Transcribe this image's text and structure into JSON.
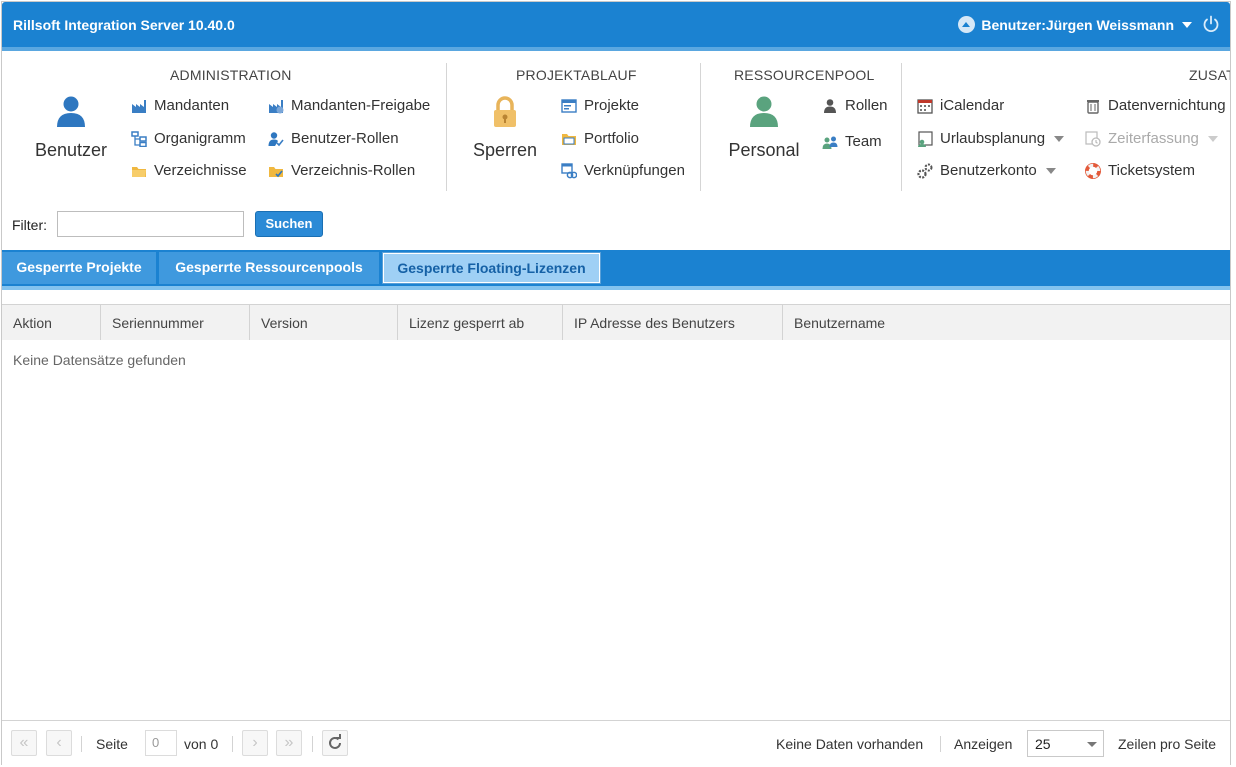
{
  "app": {
    "title": "Rillsoft Integration Server 10.40.0",
    "user_label": "Benutzer:Jürgen Weissmann"
  },
  "ribbon": {
    "administration": {
      "title": "ADMINISTRATION",
      "big_button": "Benutzer",
      "items": [
        "Mandanten",
        "Organigramm",
        "Verzeichnisse",
        "Mandanten-Freigabe",
        "Benutzer-Rollen",
        "Verzeichnis-Rollen"
      ]
    },
    "projektablauf": {
      "title": "PROJEKTABLAUF",
      "big_button": "Sperren",
      "items": [
        "Projekte",
        "Portfolio",
        "Verknüpfungen"
      ]
    },
    "ressourcenpool": {
      "title": "RESSOURCENPOOL",
      "big_button": "Personal",
      "items": [
        "Rollen",
        "Team"
      ]
    },
    "zusatz": {
      "title": "ZUSAT",
      "items": [
        "iCalendar",
        "Urlaubsplanung",
        "Benutzerkonto",
        "Datenvernichtung",
        "Zeiterfassung",
        "Ticketsystem"
      ]
    }
  },
  "filter": {
    "label": "Filter:",
    "value": "",
    "button": "Suchen"
  },
  "tabs": [
    {
      "label": "Gesperrte Projekte",
      "active": false
    },
    {
      "label": "Gesperrte Ressourcenpools",
      "active": false
    },
    {
      "label": "Gesperrte Floating-Lizenzen",
      "active": true
    }
  ],
  "grid": {
    "columns": [
      "Aktion",
      "Seriennummer",
      "Version",
      "Lizenz gesperrt ab",
      "IP Adresse des Benutzers",
      "Benutzername"
    ],
    "rows": [],
    "empty_message": "Keine Datensätze gefunden"
  },
  "pager": {
    "page_label": "Seite",
    "page_value": "0",
    "of_label": "von 0",
    "status": "Keine Daten vorhanden",
    "show_label": "Anzeigen",
    "page_size": "25",
    "rows_label": "Zeilen pro Seite"
  },
  "colors": {
    "titlebar": "#1b82d1",
    "tab_active_bg": "#9fd0f5",
    "button": "#2b8ad6"
  }
}
